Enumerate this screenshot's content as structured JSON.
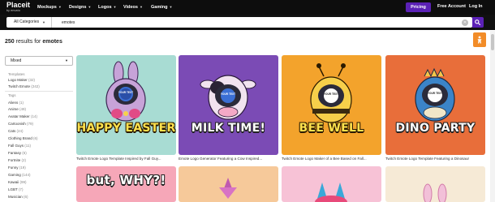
{
  "brand": {
    "name": "Placeit",
    "sub": "by envato"
  },
  "nav": {
    "items": [
      {
        "label": "Mockups"
      },
      {
        "label": "Designs"
      },
      {
        "label": "Logos"
      },
      {
        "label": "Videos"
      },
      {
        "label": "Gaming"
      }
    ],
    "pricing": "Pricing",
    "free_account": "Free Account",
    "log_in": "Log In"
  },
  "search": {
    "category": "All Categories",
    "value": "emotes"
  },
  "results": {
    "count": "250",
    "text": "results for",
    "term": "emotes"
  },
  "sidebar": {
    "sort": "Mixed",
    "templates_heading": "Templates",
    "templates": [
      {
        "label": "Logo Maker",
        "count": "(32)"
      },
      {
        "label": "Twitch Emote",
        "count": "(242)"
      }
    ],
    "tags_heading": "Tags",
    "tags": [
      {
        "label": "Aliens",
        "count": "(1)"
      },
      {
        "label": "Anime",
        "count": "(49)"
      },
      {
        "label": "Avatar Maker",
        "count": "(14)"
      },
      {
        "label": "Cartoonish",
        "count": "(79)"
      },
      {
        "label": "Cats",
        "count": "(24)"
      },
      {
        "label": "Clothing Brand",
        "count": "(6)"
      },
      {
        "label": "Fall Guys",
        "count": "(11)"
      },
      {
        "label": "Fantasy",
        "count": "(6)"
      },
      {
        "label": "Fortnite",
        "count": "(2)"
      },
      {
        "label": "Funny",
        "count": "(19)"
      },
      {
        "label": "Gaming",
        "count": "(144)"
      },
      {
        "label": "Kawaii",
        "count": "(99)"
      },
      {
        "label": "LGBT",
        "count": "(7)"
      },
      {
        "label": "Musician",
        "count": "(6)"
      }
    ]
  },
  "cards": [
    {
      "banner": "HAPPY EASTER",
      "plaque": "YOUR TEXT",
      "caption": "Twitch Emote Logo Template Inspired by Fall Guy...",
      "bg": "#a8dcd3"
    },
    {
      "banner": "MILK TIME!",
      "plaque": "YOUR TEXT",
      "caption": "Emote Logo Generator Featuring a Cow Inspired...",
      "bg": "#7b4bb5"
    },
    {
      "banner": "BEE WELL",
      "plaque": "YOUR TEXT",
      "caption": "Twitch Emote Logo Maker of a Bee Based on Fall...",
      "bg": "#f3a32c"
    },
    {
      "banner": "DINO PARTY",
      "plaque": "YOUR TEXT",
      "caption": "Twitch Emote Logo Template Featuring a Dinosaur",
      "bg": "#e86e3a"
    },
    {
      "banner": "but, WHY?!",
      "bg": "#f6a7b8"
    },
    {
      "bg": "#f6c99a"
    },
    {
      "bg": "#f7c2d6"
    },
    {
      "bg": "#f6ead6"
    }
  ],
  "colors": {
    "accent": "#5b21b6",
    "nav_bg": "#0d0d0d",
    "orange": "#f28c28"
  },
  "icons": [
    "search-icon",
    "clear-icon",
    "hand-icon",
    "chevron-down-icon"
  ]
}
